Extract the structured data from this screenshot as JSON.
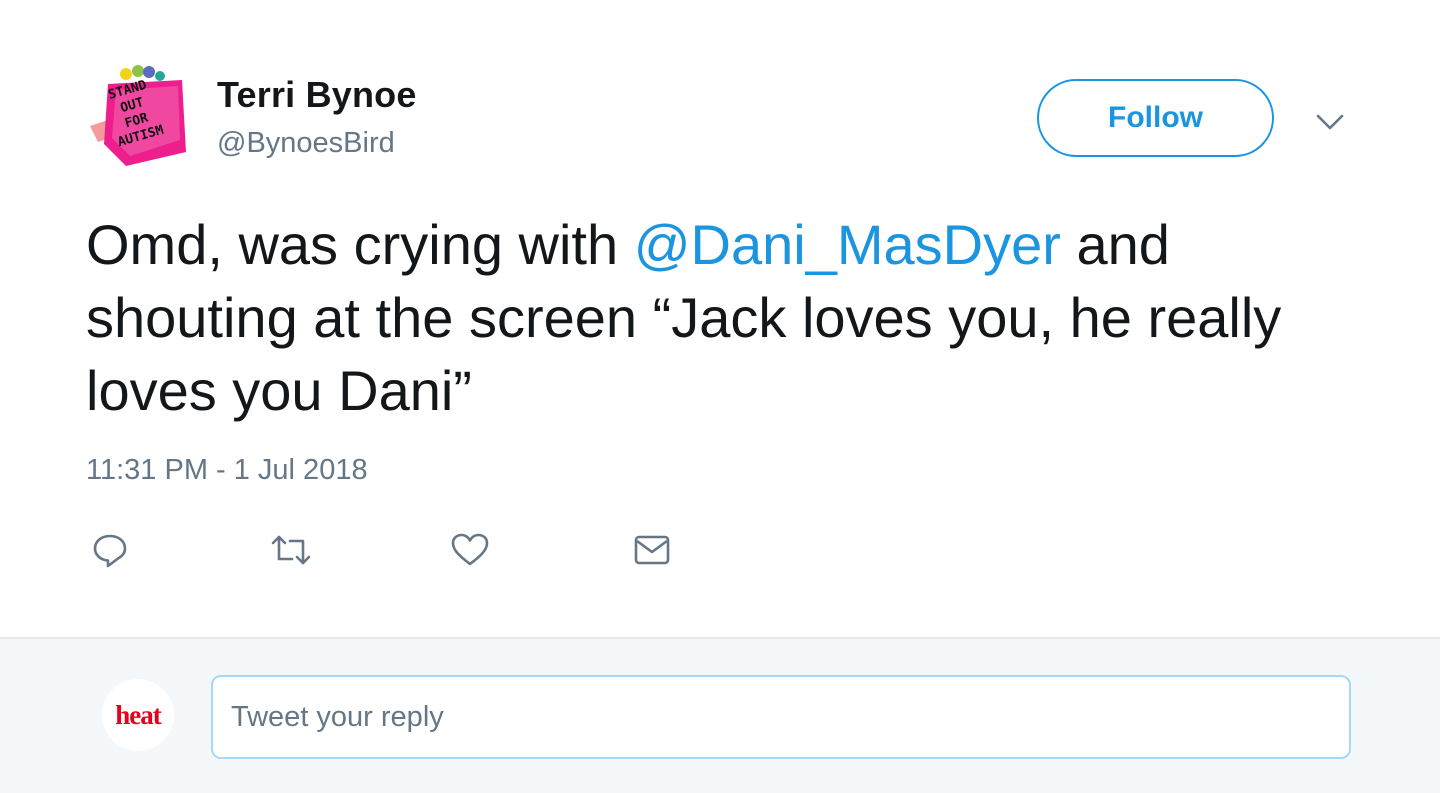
{
  "tweet": {
    "author_name": "Terri Bynoe",
    "author_handle": "@BynoesBird",
    "avatar_text": [
      "STAND",
      "OUT",
      "FOR",
      "AUTISM"
    ],
    "follow_label": "Follow",
    "text_before": "Omd, was crying with ",
    "mention": "@Dani_MasDyer",
    "text_after": " and shouting at the screen “Jack loves you, he really loves you Dani”",
    "timestamp": "11:31 PM - 1 Jul 2018",
    "actions": [
      "reply-icon",
      "retweet-icon",
      "like-icon",
      "direct-message-icon"
    ]
  },
  "reply": {
    "avatar_text": "heat",
    "placeholder": "Tweet your reply"
  },
  "colors": {
    "accent": "#1b95e0",
    "text": "#14171a",
    "muted": "#657786",
    "reply_bar_bg": "#f5f8fa",
    "heat_red": "#e5001c"
  }
}
